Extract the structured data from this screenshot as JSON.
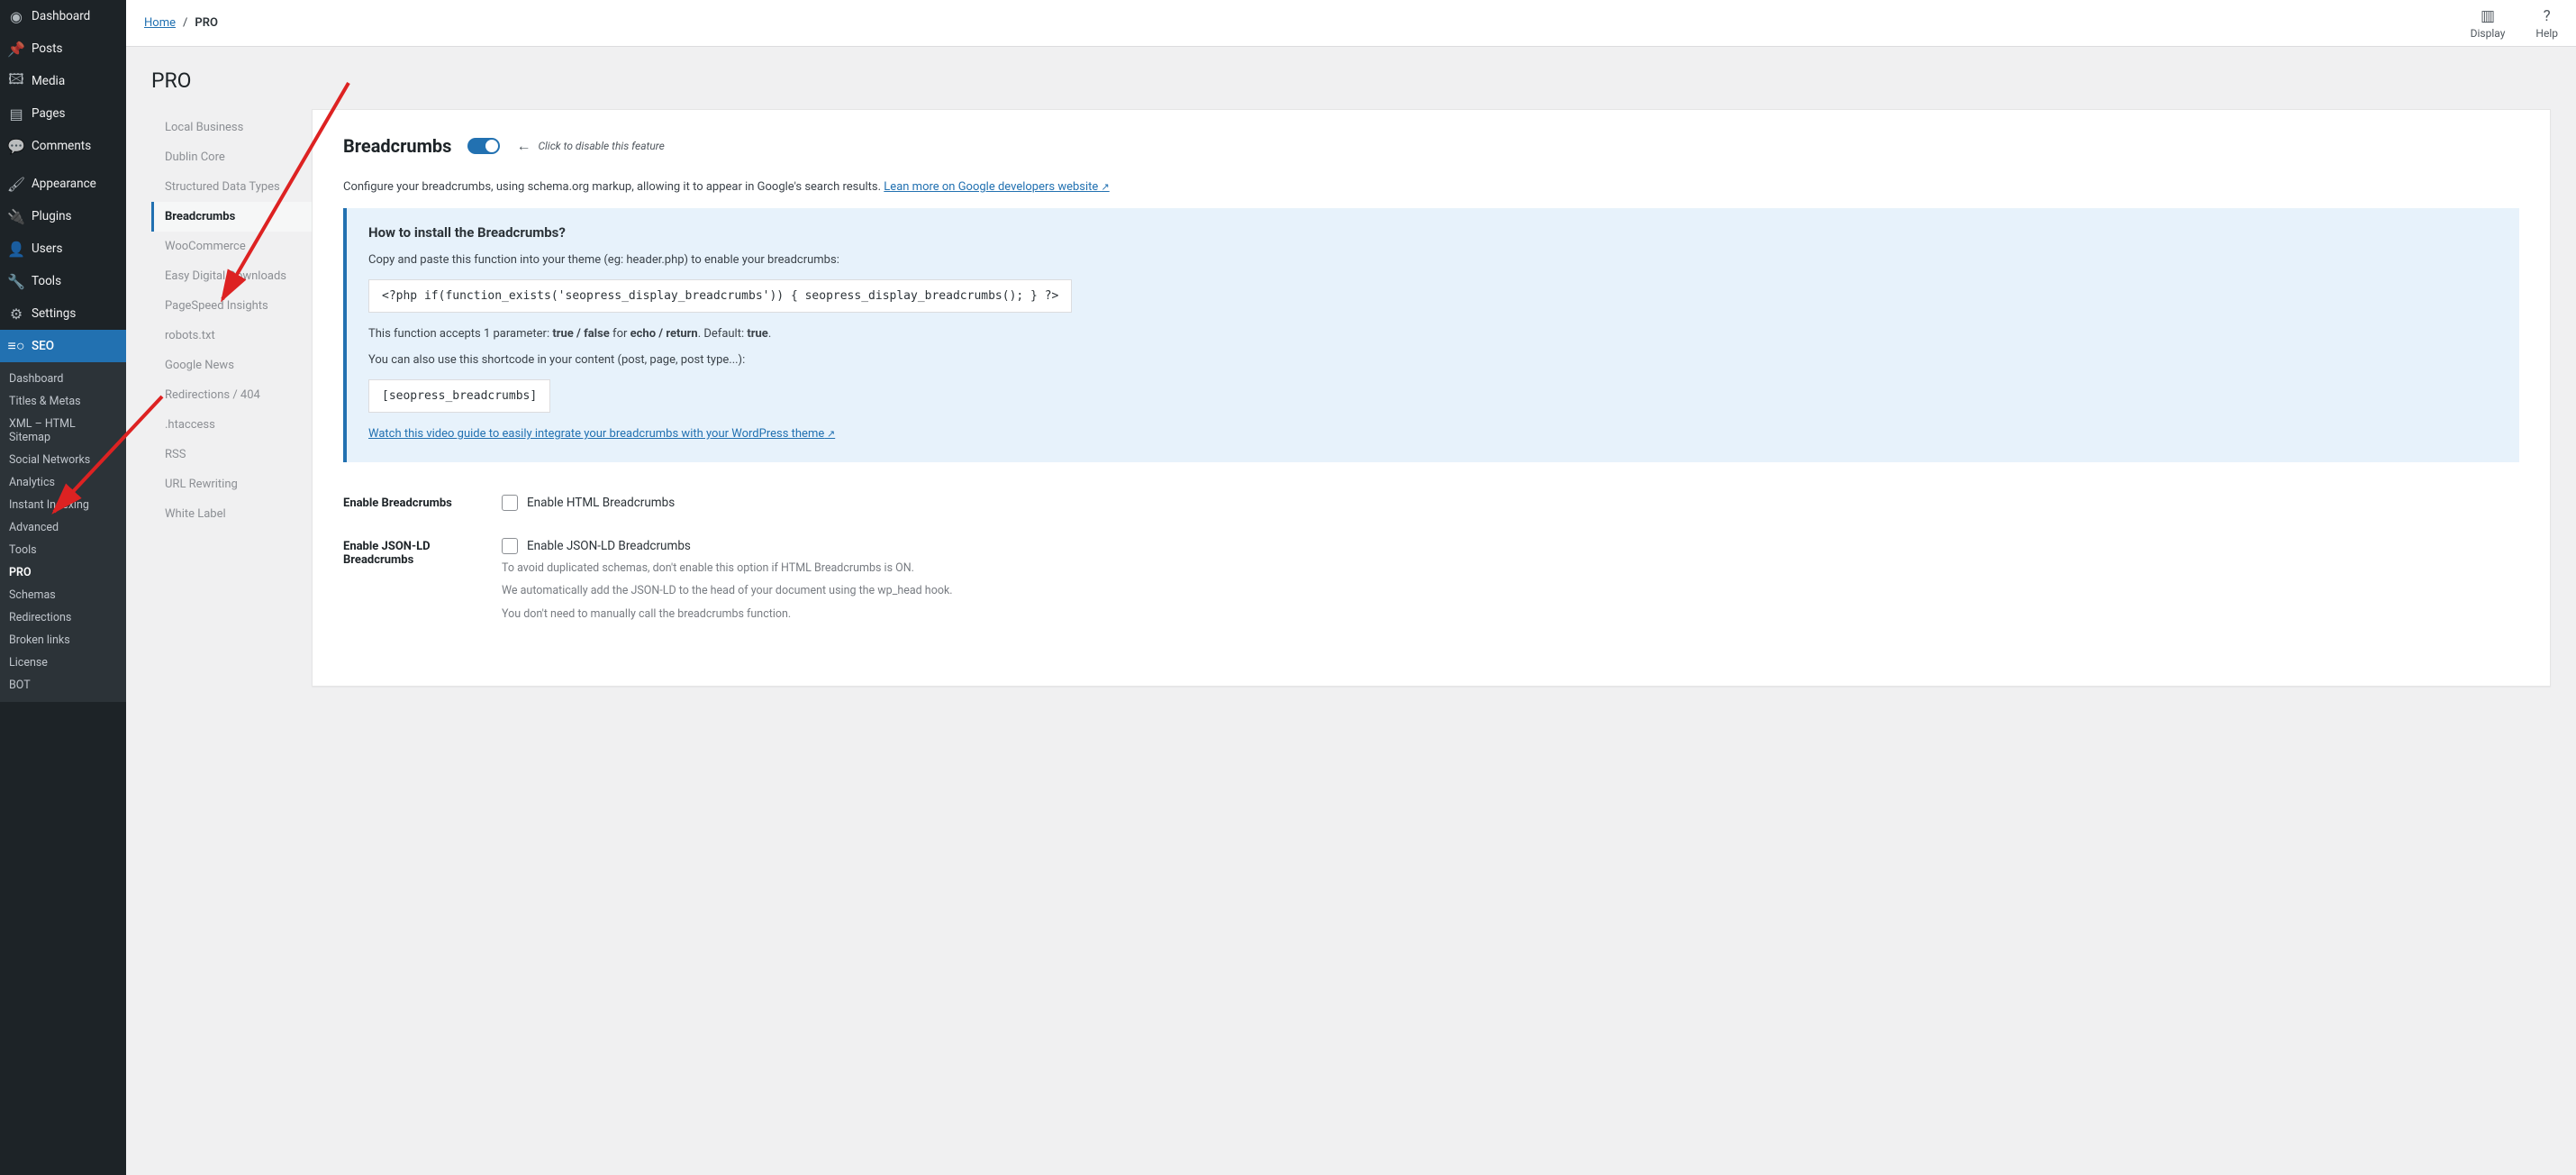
{
  "wp_menu": [
    {
      "icon": "◉",
      "label": "Dashboard"
    },
    {
      "icon": "📌",
      "label": "Posts"
    },
    {
      "icon": "🖾",
      "label": "Media"
    },
    {
      "icon": "▤",
      "label": "Pages"
    },
    {
      "icon": "💬",
      "label": "Comments"
    },
    {
      "icon": "",
      "label": "",
      "sep": true
    },
    {
      "icon": "🖌",
      "label": "Appearance"
    },
    {
      "icon": "🔌",
      "label": "Plugins"
    },
    {
      "icon": "👤",
      "label": "Users"
    },
    {
      "icon": "🔧",
      "label": "Tools"
    },
    {
      "icon": "⚙",
      "label": "Settings"
    },
    {
      "icon": "≡○",
      "label": "SEO",
      "current": true
    }
  ],
  "seo_submenu": [
    "Dashboard",
    "Titles & Metas",
    "XML – HTML Sitemap",
    "Social Networks",
    "Analytics",
    "Instant Indexing",
    "Advanced",
    "Tools",
    "PRO",
    "Schemas",
    "Redirections",
    "Broken links",
    "License",
    "BOT"
  ],
  "seo_submenu_current": "PRO",
  "breadcrumb": {
    "home": "Home",
    "current": "PRO"
  },
  "topbar": {
    "display": "Display",
    "help": "Help"
  },
  "page_title": "PRO",
  "settings_tabs": [
    "Local Business",
    "Dublin Core",
    "Structured Data Types",
    "Breadcrumbs",
    "WooCommerce",
    "Easy Digital Downloads",
    "PageSpeed Insights",
    "robots.txt",
    "Google News",
    "Redirections / 404",
    ".htaccess",
    "RSS",
    "URL Rewriting",
    "White Label"
  ],
  "settings_tab_active": "Breadcrumbs",
  "panel": {
    "heading": "Breadcrumbs",
    "toggle_hint": "Click to disable this feature",
    "desc_text": "Configure your breadcrumbs, using schema.org markup, allowing it to appear in Google's search results. ",
    "desc_link": "Lean more on Google developers website ",
    "callout_title": "How to install the Breadcrumbs?",
    "callout_p1": "Copy and paste this function into your theme (eg: header.php) to enable your breadcrumbs:",
    "code1": "<?php if(function_exists('seopress_display_breadcrumbs')) { seopress_display_breadcrumbs(); } ?>",
    "callout_p2_a": "This function accepts 1 parameter: ",
    "callout_p2_b": "true / false",
    "callout_p2_c": " for ",
    "callout_p2_d": "echo / return",
    "callout_p2_e": ". Default: ",
    "callout_p2_f": "true",
    "callout_p2_g": ".",
    "callout_p3": "You can also use this shortcode in your content (post, page, post type...):",
    "code2": "[seopress_breadcrumbs]",
    "video_link": "Watch this video guide to easily integrate your breadcrumbs with your WordPress theme",
    "row1_label": "Enable Breadcrumbs",
    "row1_check": "Enable HTML Breadcrumbs",
    "row2_label": "Enable JSON-LD Breadcrumbs",
    "row2_check": "Enable JSON-LD Breadcrumbs",
    "row2_hint1": "To avoid duplicated schemas, don't enable this option if HTML Breadcrumbs is ON.",
    "row2_hint2": "We automatically add the JSON-LD to the head of your document using the wp_head hook.",
    "row2_hint3": "You don't need to manually call the breadcrumbs function."
  }
}
